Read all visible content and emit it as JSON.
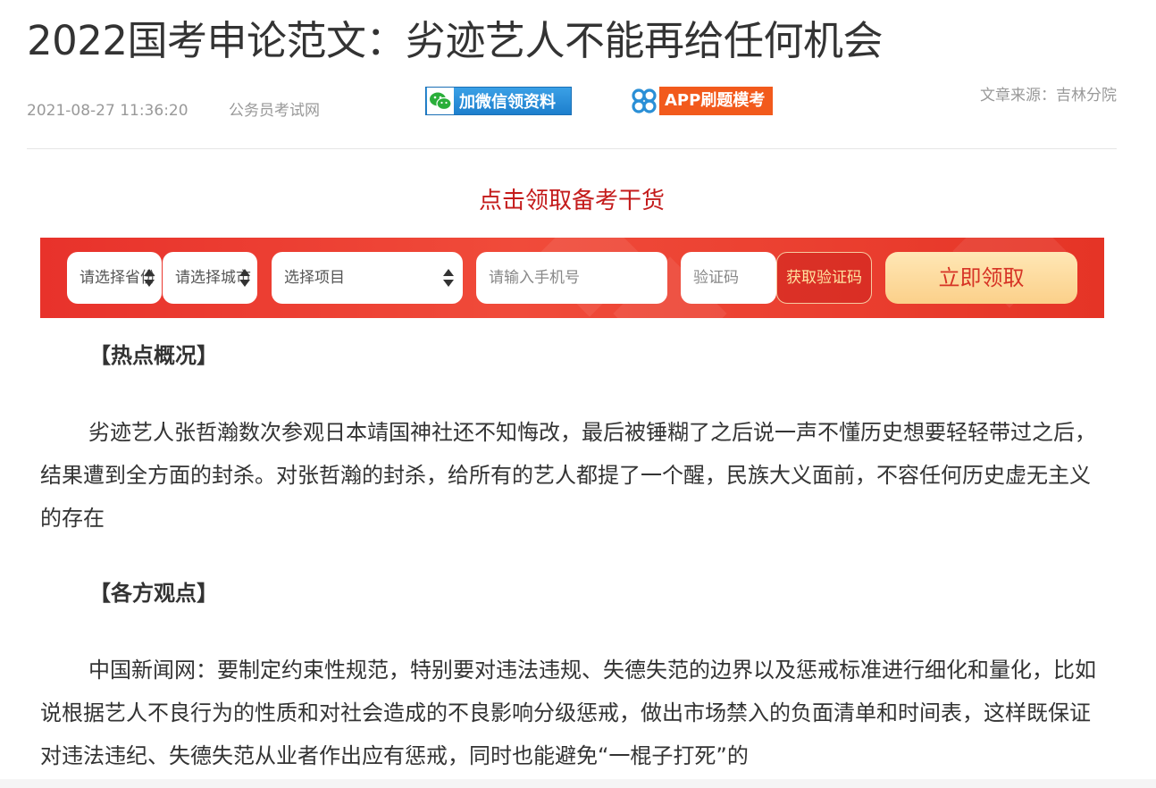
{
  "article": {
    "title": "2022国考申论范文：劣迹艺人不能再给任何机会",
    "date": "2021-08-27 11:36:20",
    "site": "公务员考试网",
    "source": "文章来源：吉林分院"
  },
  "banners": {
    "wechat_label": "加微信领资料",
    "app_label": "APP刷题模考"
  },
  "promo": {
    "heading": "点击领取备考干货",
    "province_placeholder": "请选择省份",
    "city_placeholder": "请选择城市",
    "project_placeholder": "选择项目",
    "phone_placeholder": "请输入手机号",
    "code_placeholder": "验证码",
    "sms_button": "获取验证码",
    "submit_button": "立即领取",
    "colors": {
      "bar": "#e8322b",
      "submit_bg": "#fbd08a",
      "submit_text": "#d63325",
      "heading": "#c41b1b"
    }
  },
  "sections": [
    {
      "heading": "【热点概况】",
      "paragraph": "劣迹艺人张哲瀚数次参观日本靖国神社还不知悔改，最后被锤糊了之后说一声不懂历史想要轻轻带过之后，结果遭到全方面的封杀。对张哲瀚的封杀，给所有的艺人都提了一个醒，民族大义面前，不容任何历史虚无主义的存在"
    },
    {
      "heading": "【各方观点】",
      "paragraph": "中国新闻网：要制定约束性规范，特别要对违法违规、失德失范的边界以及惩戒标准进行细化和量化，比如说根据艺人不良行为的性质和对社会造成的不良影响分级惩戒，做出市场禁入的负面清单和时间表，这样既保证对违法违纪、失德失范从业者作出应有惩戒，同时也能避免“一棍子打死”的"
    }
  ]
}
